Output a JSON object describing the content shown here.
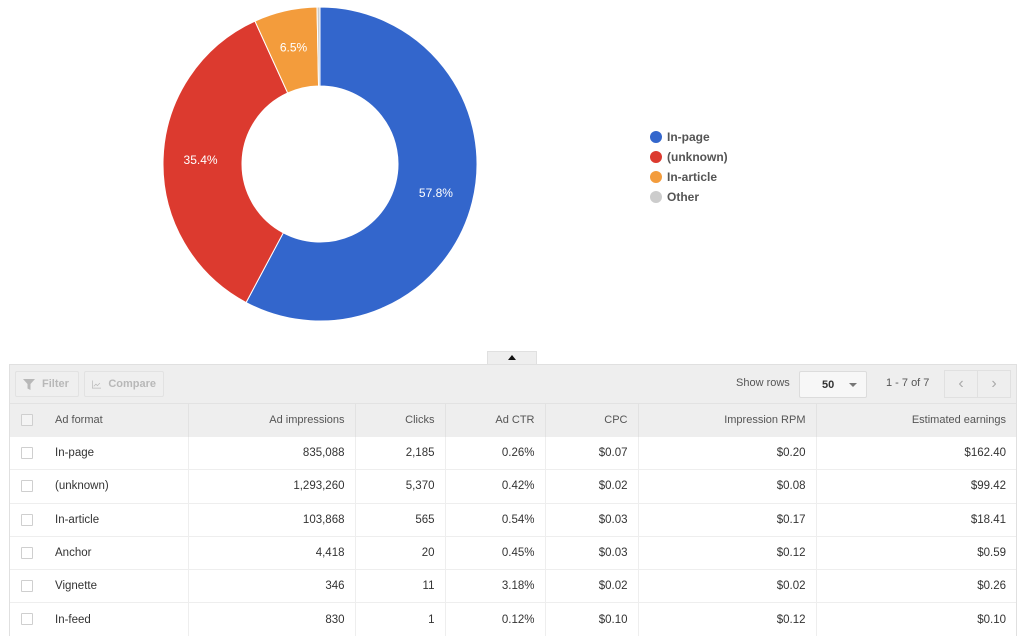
{
  "chart_data": {
    "type": "pie",
    "variant": "donut",
    "title": "",
    "series": [
      {
        "name": "In-page",
        "value": 57.8,
        "label": "57.8%",
        "color": "#3366cc"
      },
      {
        "name": "(unknown)",
        "value": 35.4,
        "label": "35.4%",
        "color": "#dc3912"
      },
      {
        "name": "In-article",
        "value": 6.5,
        "label": "6.5%",
        "color": "#ff9900"
      },
      {
        "name": "Other",
        "value": 0.3,
        "label": "",
        "color": "#cccccc"
      }
    ],
    "start_angle_deg": 0,
    "direction": "clockwise",
    "legend_position": "right"
  },
  "slice_colors_display": {
    "In-page": "#3366cc",
    "(unknown)": "#dc3a2f",
    "In-article": "#f39c3c",
    "Other": "#cccccc"
  },
  "legend": [
    {
      "label": "In-page",
      "color": "#3366cc"
    },
    {
      "label": "(unknown)",
      "color": "#dc3a2f"
    },
    {
      "label": "In-article",
      "color": "#f39c3c"
    },
    {
      "label": "Other",
      "color": "#cccccc"
    }
  ],
  "toolbar": {
    "filter_label": "Filter",
    "compare_label": "Compare",
    "show_rows_label": "Show rows",
    "rows_value": "50",
    "range_text": "1 - 7 of 7",
    "prev_icon": "‹",
    "next_icon": "›"
  },
  "table": {
    "headers": [
      "Ad format",
      "Ad impressions",
      "Clicks",
      "Ad CTR",
      "CPC",
      "Impression RPM",
      "Estimated earnings"
    ],
    "rows": [
      [
        "In-page",
        "835,088",
        "2,185",
        "0.26%",
        "$0.07",
        "$0.20",
        "$162.40"
      ],
      [
        "(unknown)",
        "1,293,260",
        "5,370",
        "0.42%",
        "$0.02",
        "$0.08",
        "$99.42"
      ],
      [
        "In-article",
        "103,868",
        "565",
        "0.54%",
        "$0.03",
        "$0.17",
        "$18.41"
      ],
      [
        "Anchor",
        "4,418",
        "20",
        "0.45%",
        "$0.03",
        "$0.12",
        "$0.59"
      ],
      [
        "Vignette",
        "346",
        "11",
        "3.18%",
        "$0.02",
        "$0.02",
        "$0.26"
      ],
      [
        "In-feed",
        "830",
        "1",
        "0.12%",
        "$0.10",
        "$0.12",
        "$0.10"
      ]
    ]
  }
}
